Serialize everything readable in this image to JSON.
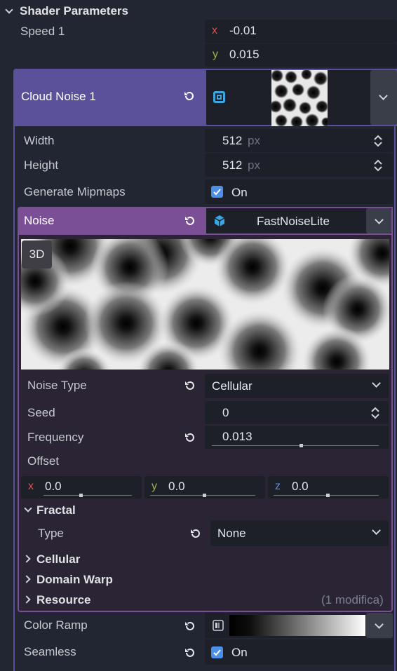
{
  "section": {
    "title": "Shader Parameters"
  },
  "speed": {
    "label": "Speed 1",
    "x_axis": "x",
    "x_value": "-0.01",
    "y_axis": "y",
    "y_value": "0.015"
  },
  "cloud_noise": {
    "label": "Cloud Noise 1"
  },
  "width": {
    "label": "Width",
    "value": "512",
    "unit": "px"
  },
  "height": {
    "label": "Height",
    "value": "512",
    "unit": "px"
  },
  "mipmaps": {
    "label": "Generate Mipmaps",
    "state": "On"
  },
  "noise": {
    "label": "Noise",
    "resource": "FastNoiseLite",
    "badge": "3D"
  },
  "noise_type": {
    "label": "Noise Type",
    "value": "Cellular"
  },
  "seed": {
    "label": "Seed",
    "value": "0"
  },
  "frequency": {
    "label": "Frequency",
    "value": "0.013",
    "level": 0.5
  },
  "offset": {
    "label": "Offset",
    "x_axis": "x",
    "x_value": "0.0",
    "y_axis": "y",
    "y_value": "0.0",
    "z_axis": "z",
    "z_value": "0.0"
  },
  "fractal": {
    "label": "Fractal",
    "type_label": "Type",
    "type_value": "None"
  },
  "cellular": {
    "label": "Cellular"
  },
  "domain_warp": {
    "label": "Domain Warp"
  },
  "resource": {
    "label": "Resource",
    "note": "(1 modifica)"
  },
  "color_ramp": {
    "label": "Color Ramp"
  },
  "seamless": {
    "label": "Seamless",
    "state": "On"
  },
  "colors": {
    "cloud_header": "#5a519a",
    "noise_header": "#7a4f96",
    "noise_border": "#8c64b0",
    "accent_check": "#4b8fe8",
    "axis_x": "#d9534f",
    "axis_y": "#a3b24c",
    "axis_z": "#5b8fd6"
  }
}
